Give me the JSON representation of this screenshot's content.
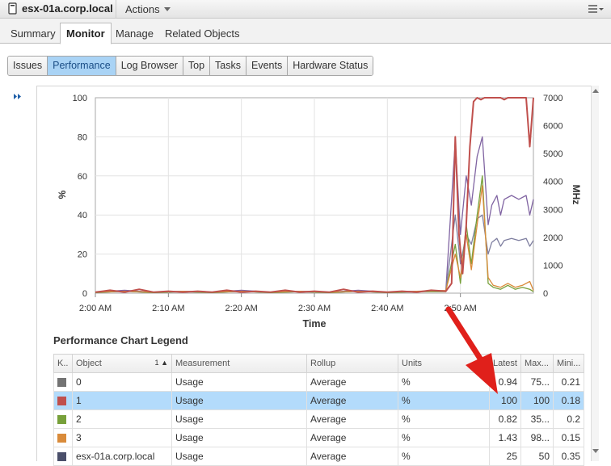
{
  "header": {
    "host_name": "esx-01a.corp.local",
    "actions_label": "Actions"
  },
  "primary_tabs": [
    "Summary",
    "Monitor",
    "Manage",
    "Related Objects"
  ],
  "active_primary_tab": "Monitor",
  "sub_tabs": [
    "Issues",
    "Performance",
    "Log Browser",
    "Top",
    "Tasks",
    "Events",
    "Hardware Status"
  ],
  "active_sub_tab": "Performance",
  "chart_data": {
    "type": "line",
    "xlabel": "Time",
    "ylabel": "%",
    "ylabel_right": "MHz",
    "x_ticks": [
      "2:00 AM",
      "2:10 AM",
      "2:20 AM",
      "2:30 AM",
      "2:40 AM",
      "2:50 AM"
    ],
    "y_ticks": [
      0,
      20,
      40,
      60,
      80,
      100
    ],
    "y_right_ticks": [
      0,
      1000,
      2000,
      3000,
      4000,
      5000,
      6000,
      7000
    ],
    "ylim": [
      0,
      100
    ],
    "ylim_right": [
      0,
      7000
    ],
    "grid": true,
    "series": [
      {
        "name": "1",
        "color": "#c0504d",
        "x": [
          0,
          2,
          4,
          6,
          8,
          10,
          12,
          14,
          16,
          18,
          20,
          22,
          24,
          26,
          28,
          30,
          32,
          34,
          36,
          38,
          40,
          42,
          44,
          46,
          48,
          48.8,
          49.3,
          49.8,
          50.3,
          50.8,
          51.3,
          51.8,
          52.3,
          52.8,
          53.3,
          53.8,
          54.3,
          55,
          55.5,
          56,
          56.5,
          57,
          57.5,
          58,
          58.5,
          59,
          59.5,
          60
        ],
        "values": [
          0.5,
          1.5,
          0.5,
          2,
          0.5,
          1,
          0.5,
          1,
          0.5,
          1.5,
          0.5,
          1,
          0.5,
          1.5,
          0.5,
          1,
          0.5,
          2,
          0.5,
          1,
          0.5,
          1,
          0.5,
          1.5,
          1,
          5,
          80,
          30,
          10,
          35,
          75,
          98,
          100,
          99,
          100,
          100,
          100,
          100,
          100,
          99,
          100,
          100,
          100,
          100,
          100,
          100,
          75,
          100
        ]
      },
      {
        "name": "0",
        "color": "#8064a2",
        "x": [
          0,
          4,
          8,
          12,
          16,
          20,
          24,
          28,
          32,
          36,
          40,
          44,
          48,
          49.3,
          50,
          50.8,
          51.5,
          52.3,
          53,
          53.8,
          54.3,
          55,
          55.5,
          56,
          57,
          58,
          59,
          59.5,
          60
        ],
        "values": [
          0.5,
          1.5,
          0.5,
          1,
          0.5,
          1.5,
          0.5,
          1,
          0.5,
          1.5,
          0.5,
          1,
          1,
          78,
          30,
          60,
          45,
          70,
          80,
          35,
          45,
          50,
          40,
          48,
          50,
          48,
          50,
          40,
          48
        ]
      },
      {
        "name": "esx-01a.corp.local",
        "color": "#7f7fa0",
        "x": [
          0,
          4,
          8,
          12,
          16,
          20,
          24,
          28,
          32,
          36,
          40,
          44,
          48,
          49.3,
          50,
          50.8,
          51.5,
          52.3,
          53,
          53.8,
          54.3,
          55,
          55.5,
          56,
          57,
          58,
          59,
          59.5,
          60
        ],
        "values": [
          0.3,
          1,
          0.3,
          0.8,
          0.3,
          1,
          0.3,
          0.8,
          0.3,
          1,
          0.3,
          0.8,
          1,
          40,
          15,
          30,
          25,
          38,
          40,
          20,
          26,
          28,
          24,
          27,
          28,
          27,
          28,
          24,
          27
        ]
      },
      {
        "name": "2",
        "color": "#77a03a",
        "x": [
          0,
          4,
          8,
          12,
          16,
          20,
          24,
          28,
          32,
          36,
          40,
          44,
          48,
          49.3,
          50,
          50.8,
          51.5,
          52.3,
          53,
          53.8,
          54.5,
          55.5,
          56.5,
          57.5,
          58.5,
          59.5,
          60
        ],
        "values": [
          0.3,
          1,
          0.3,
          0.8,
          0.3,
          1,
          0.3,
          0.8,
          0.3,
          1,
          0.3,
          0.8,
          0.8,
          25,
          5,
          35,
          15,
          40,
          60,
          5,
          3,
          2,
          4,
          2,
          3,
          2,
          0.8
        ]
      },
      {
        "name": "3",
        "color": "#d98b3a",
        "x": [
          0,
          4,
          8,
          12,
          16,
          20,
          24,
          28,
          32,
          36,
          40,
          44,
          48,
          49.3,
          50,
          50.8,
          51.5,
          52.3,
          53,
          53.8,
          54.5,
          55.5,
          56.5,
          57.5,
          58.5,
          59.5,
          60
        ],
        "values": [
          0.5,
          1,
          0.5,
          1,
          0.5,
          1,
          0.5,
          1,
          0.5,
          1,
          0.5,
          1,
          1.4,
          20,
          8,
          30,
          12,
          35,
          55,
          8,
          4,
          3,
          5,
          3,
          4,
          6,
          1.4
        ]
      }
    ]
  },
  "legend": {
    "title": "Performance Chart Legend",
    "columns": [
      "K..",
      "Object",
      "Measurement",
      "Rollup",
      "Units",
      "Latest",
      "Max...",
      "Mini..."
    ],
    "sort_indicator": "1",
    "rows": [
      {
        "color": "#737373",
        "object": "0",
        "measurement": "Usage",
        "rollup": "Average",
        "units": "%",
        "latest": "0.94",
        "max": "75...",
        "min": "0.21"
      },
      {
        "color": "#c0504d",
        "object": "1",
        "measurement": "Usage",
        "rollup": "Average",
        "units": "%",
        "latest": "100",
        "max": "100",
        "min": "0.18"
      },
      {
        "color": "#77a03a",
        "object": "2",
        "measurement": "Usage",
        "rollup": "Average",
        "units": "%",
        "latest": "0.82",
        "max": "35...",
        "min": "0.2"
      },
      {
        "color": "#d98b3a",
        "object": "3",
        "measurement": "Usage",
        "rollup": "Average",
        "units": "%",
        "latest": "1.43",
        "max": "98...",
        "min": "0.15"
      },
      {
        "color": "#4a4f6a",
        "object": "esx-01a.corp.local",
        "measurement": "Usage",
        "rollup": "Average",
        "units": "%",
        "latest": "25",
        "max": "50",
        "min": "0.35"
      }
    ],
    "selected_row": 1
  },
  "colors": {
    "selected_row": "#b3dbfb",
    "active_tab": "#a9d3f5",
    "annotation_arrow": "#e0201b"
  }
}
